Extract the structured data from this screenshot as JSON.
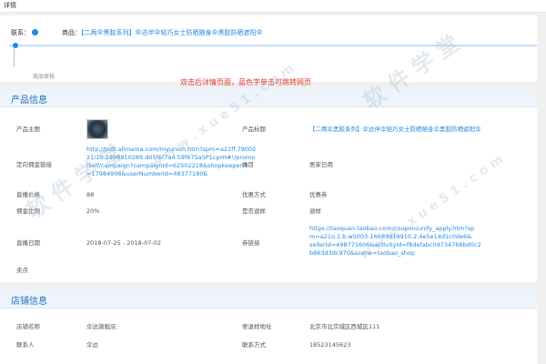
{
  "header": {
    "title": "详情"
  },
  "contact": {
    "label": "联系："
  },
  "product_bar": {
    "label": "商品：",
    "value": "【二两伞黑胶系列】伞达伴伞轻巧女士防晒随身伞黑胶防晒遮阳伞"
  },
  "timeline": {
    "label": "商品审核"
  },
  "hint": "双击后详情页面，蓝色字单击可跳转网页",
  "product_section": {
    "title": "产品信息",
    "main_image_label": "产品主图",
    "title_label": "产品标题",
    "title_value": "【二两伞黑胶系列】伞达伴伞轻巧女士防晒随身伞黑胶防晒遮阳伞",
    "commission_link_label": "定向佣金链接",
    "commission_link_lines": [
      "http://pub.alimama.com/myunion.htm?spm=a21ff.79002",
      "21/10.1998910289.d05f6f7a4.59f675a5P1cprH#!/promo",
      "/self/campaign?campaignId=62502218&shopkeeperId",
      "=17984906&userNumberId=48377180Б"
    ],
    "category_label": "类目",
    "category_value": "居家日用",
    "live_price_label": "直播价格",
    "live_price_value": "88",
    "discount_label": "优惠方式",
    "discount_value": "优惠券",
    "commission_ratio_label": "佣金比例",
    "commission_ratio_value": "20%",
    "return_label": "是否退样",
    "return_value": "退样",
    "live_date_label": "直播日期",
    "live_date_value": "2018-07-25 - 2018-07-02",
    "coupon_link_label": "券链接",
    "coupon_link_lines": [
      "https://taoquan.taobao.com/coupon/unify_apply.htm?sp",
      "m=a21o.1.b.w5003-16689914910.2.4e5e14d1c0de6&",
      "sellerId=498771606&activityId=f8defabc04734768bd0c2",
      "b863d3dc970&scene=taobao_shop"
    ],
    "selling_point_label": "卖点"
  },
  "shop_section": {
    "title": "店铺信息",
    "shop_name_label": "店铺名称",
    "shop_name_value": "伞达旗舰店",
    "return_address_label": "寄退样地址",
    "return_address_value": "北京市北京城区西城区111",
    "contact_person_label": "联系人",
    "contact_person_value": "伞达",
    "contact_method_label": "联系方式",
    "contact_method_value": "18523145623"
  },
  "watermarks": [
    "软 件 学 堂",
    "w w w . x u e 5 1 . c o m",
    "软 件 学 堂",
    "w w w . x u e 5 1 . c o m"
  ]
}
